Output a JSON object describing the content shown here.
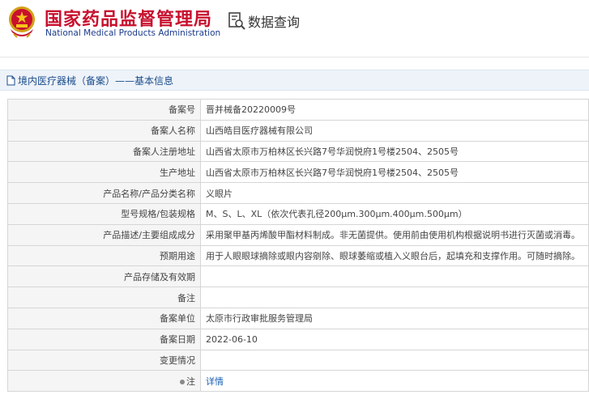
{
  "header": {
    "org_name_cn": "国家药品监督管理局",
    "org_name_en": "National Medical Products Administration",
    "query_label": "数据查询",
    "brand_color": "#c8102e"
  },
  "breadcrumb": {
    "text": "境内医疗器械（备案）——基本信息"
  },
  "record": {
    "rows": [
      {
        "key": "备案号",
        "value": "晋并械备20220009号"
      },
      {
        "key": "备案人名称",
        "value": "山西皓目医疗器械有限公司"
      },
      {
        "key": "备案人注册地址",
        "value": "山西省太原市万柏林区长兴路7号华润悦府1号楼2504、2505号"
      },
      {
        "key": "生产地址",
        "value": "山西省太原市万柏林区长兴路7号华润悦府1号楼2504、2505号"
      },
      {
        "key": "产品名称/产品分类名称",
        "value": "义眼片"
      },
      {
        "key": "型号规格/包装规格",
        "value": "M、S、L、XL（依次代表孔径200μm.300μm.400μm.500μm）"
      },
      {
        "key": "产品描述/主要组成成分",
        "value": "采用聚甲基丙烯酸甲酯材料制成。非无菌提供。使用前由使用机构根据说明书进行灭菌或消毒。"
      },
      {
        "key": "预期用途",
        "value": "用于人眼眼球摘除或眼内容剜除、眼球萎缩或植入义眼台后，起填充和支撑作用。可随时摘除。"
      },
      {
        "key": "产品存储及有效期",
        "value": ""
      },
      {
        "key": "备注",
        "value": ""
      },
      {
        "key": "备案单位",
        "value": "太原市行政审批服务管理局"
      },
      {
        "key": "备案日期",
        "value": "2022-06-10"
      },
      {
        "key": "变更情况",
        "value": ""
      }
    ],
    "note_key": "注",
    "note_link": "详情"
  }
}
